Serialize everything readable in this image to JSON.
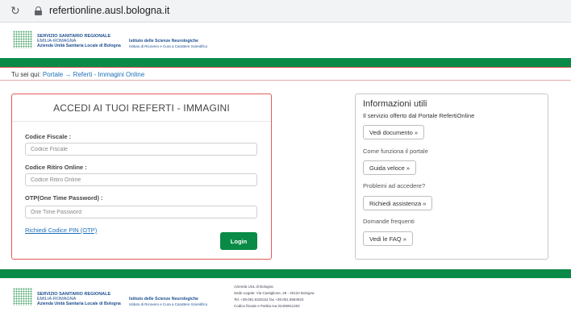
{
  "browser": {
    "url": "refertionline.ausl.bologna.it",
    "reload_icon": "reload-icon",
    "lock_icon": "lock-icon"
  },
  "header": {
    "ssr_title": "SERVIZIO SANITARIO REGIONALE",
    "ssr_region": "EMILIA-ROMAGNA",
    "ssr_azienda": "Azienda Unità Sanitaria Locale di Bologna",
    "isn_title": "Istituto delle Scienze Neurologiche",
    "isn_sub": "Istituto di Ricovero e Cura a Carattere Scientifico"
  },
  "breadcrumb": {
    "prefix": "Tu sei qui:",
    "portale": "Portale",
    "arrow": "→",
    "current": "Referti - Immagini Online"
  },
  "login": {
    "title": "ACCEDI AI TUOI REFERTI - IMMAGINI",
    "codice_fiscale_label": "Codice Fiscale :",
    "codice_fiscale_placeholder": "Codice Fiscale",
    "codice_ritiro_label": "Codice Ritiro Online :",
    "codice_ritiro_placeholder": "Codice Ritiro Online",
    "otp_label": "OTP(One Time Password) :",
    "otp_placeholder": "One Time Password",
    "pin_link": "Richiedi Codice PIN (OTP)",
    "login_button": "Login"
  },
  "info": {
    "title": "Informazioni utili",
    "subtitle": "Il servizio offerto dal Portale RefertiOnline",
    "vedi_documento": "Vedi documento »",
    "come_funziona": "Come funziona il portale",
    "guida_veloce": "Guida veloce »",
    "problemi": "Problemi ad accedere?",
    "richiedi_assistenza": "Richiedi assistenza »",
    "domande": "Domande frequenti",
    "vedi_faq": "Vedi le FAQ »"
  },
  "footer": {
    "ssr_title": "SERVIZIO SANITARIO REGIONALE",
    "ssr_region": "EMILIA-ROMAGNA",
    "ssr_azienda": "Azienda Unità Sanitaria Locale di Bologna",
    "isn_title": "Istituto delle Scienze Neurologiche",
    "isn_sub": "Istituto di Ricovero e Cura a Carattere Scientifico",
    "addr_name": "Azienda USL di Bologna",
    "addr_sede": "Sede Legale: Via Castiglione, 29 - 40124 Bologna",
    "addr_tel": "Tel. +39.051.6225111 fax +39.051.6584923",
    "addr_cf": "Codice fiscale e Partita Iva 02406911202"
  },
  "colors": {
    "brand_green": "#0a8a47",
    "brand_blue": "#1d4f91",
    "accent_red": "#e05a5a",
    "link_blue": "#1d6fb8"
  }
}
